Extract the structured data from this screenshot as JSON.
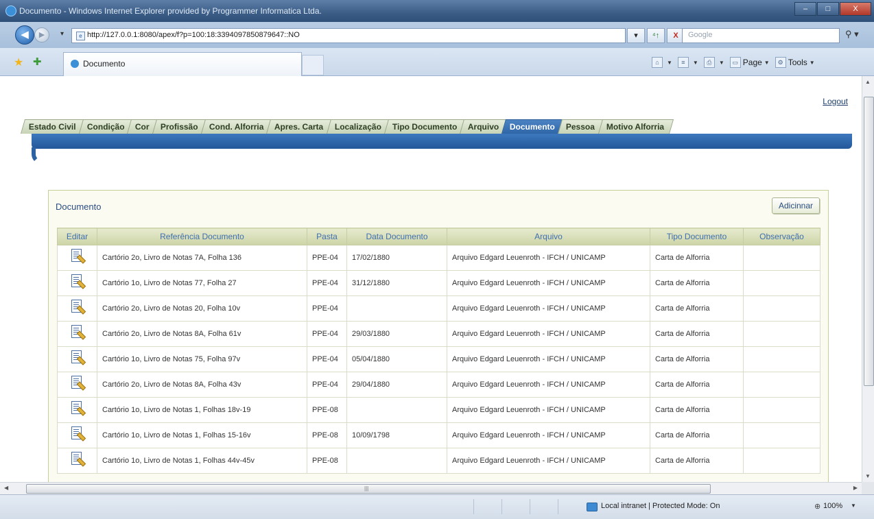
{
  "window": {
    "title": "Documento - Windows Internet Explorer provided by Programmer Informatica Ltda.",
    "minimize": "–",
    "maximize": "□",
    "close": "X"
  },
  "address_bar": {
    "url": "http://127.0.0.1:8080/apex/f?p=100:18:3394097850879647::NO",
    "search_placeholder": "Google",
    "refresh": "⁴↑",
    "stop": "X"
  },
  "tab": {
    "label": "Documento"
  },
  "command_bar": {
    "page": "Page",
    "tools": "Tools"
  },
  "app": {
    "logout": "Logout",
    "tabs": [
      "Estado Civil",
      "Condição",
      "Cor",
      "Profissão",
      "Cond. Alforria",
      "Apres. Carta",
      "Localização",
      "Tipo Documento",
      "Arquivo",
      "Documento",
      "Pessoa",
      "Motivo Alforria"
    ],
    "active_tab": "Documento",
    "region_title": "Documento",
    "add_button": "Adicinnar",
    "columns": [
      "Editar",
      "Referência Documento",
      "Pasta",
      "Data Documento",
      "Arquivo",
      "Tipo Documento",
      "Observação"
    ],
    "rows": [
      {
        "ref": "Cartório 2o, Livro de Notas 7A, Folha 136",
        "pasta": "PPE-04",
        "data": "17/02/1880",
        "arquivo": "Arquivo Edgard Leuenroth - IFCH / UNICAMP",
        "tipo": "Carta de Alforria",
        "obs": ""
      },
      {
        "ref": "Cartório 1o, Livro de Notas 77, Folha 27",
        "pasta": "PPE-04",
        "data": "31/12/1880",
        "arquivo": "Arquivo Edgard Leuenroth - IFCH / UNICAMP",
        "tipo": "Carta de Alforria",
        "obs": ""
      },
      {
        "ref": "Cartório 2o, Livro de Notas 20, Folha 10v",
        "pasta": "PPE-04",
        "data": "",
        "arquivo": "Arquivo Edgard Leuenroth - IFCH / UNICAMP",
        "tipo": "Carta de Alforria",
        "obs": ""
      },
      {
        "ref": "Cartório 2o, Livro de Notas 8A, Folha 61v",
        "pasta": "PPE-04",
        "data": "29/03/1880",
        "arquivo": "Arquivo Edgard Leuenroth - IFCH / UNICAMP",
        "tipo": "Carta de Alforria",
        "obs": ""
      },
      {
        "ref": "Cartório 1o, Livro de Notas 75, Folha 97v",
        "pasta": "PPE-04",
        "data": "05/04/1880",
        "arquivo": "Arquivo Edgard Leuenroth - IFCH / UNICAMP",
        "tipo": "Carta de Alforria",
        "obs": ""
      },
      {
        "ref": "Cartório 2o, Livro de Notas 8A, Folha 43v",
        "pasta": "PPE-04",
        "data": "29/04/1880",
        "arquivo": "Arquivo Edgard Leuenroth - IFCH / UNICAMP",
        "tipo": "Carta de Alforria",
        "obs": ""
      },
      {
        "ref": "Cartório 1o, Livro de Notas 1, Folhas 18v-19",
        "pasta": "PPE-08",
        "data": "",
        "arquivo": "Arquivo Edgard Leuenroth - IFCH / UNICAMP",
        "tipo": "Carta de Alforria",
        "obs": ""
      },
      {
        "ref": "Cartório 1o, Livro de Notas 1, Folhas 15-16v",
        "pasta": "PPE-08",
        "data": "10/09/1798",
        "arquivo": "Arquivo Edgard Leuenroth - IFCH / UNICAMP",
        "tipo": "Carta de Alforria",
        "obs": ""
      },
      {
        "ref": "Cartório 1o, Livro de Notas 1, Folhas 44v-45v",
        "pasta": "PPE-08",
        "data": "",
        "arquivo": "Arquivo Edgard Leuenroth - IFCH / UNICAMP",
        "tipo": "Carta de Alforria",
        "obs": ""
      }
    ]
  },
  "status_bar": {
    "zone": "Local intranet | Protected Mode: On",
    "zoom": "100%"
  },
  "colors": {
    "accent_blue": "#2f66a8",
    "header_olive": "#ccd4a6",
    "link_blue": "#3f6eb0"
  }
}
